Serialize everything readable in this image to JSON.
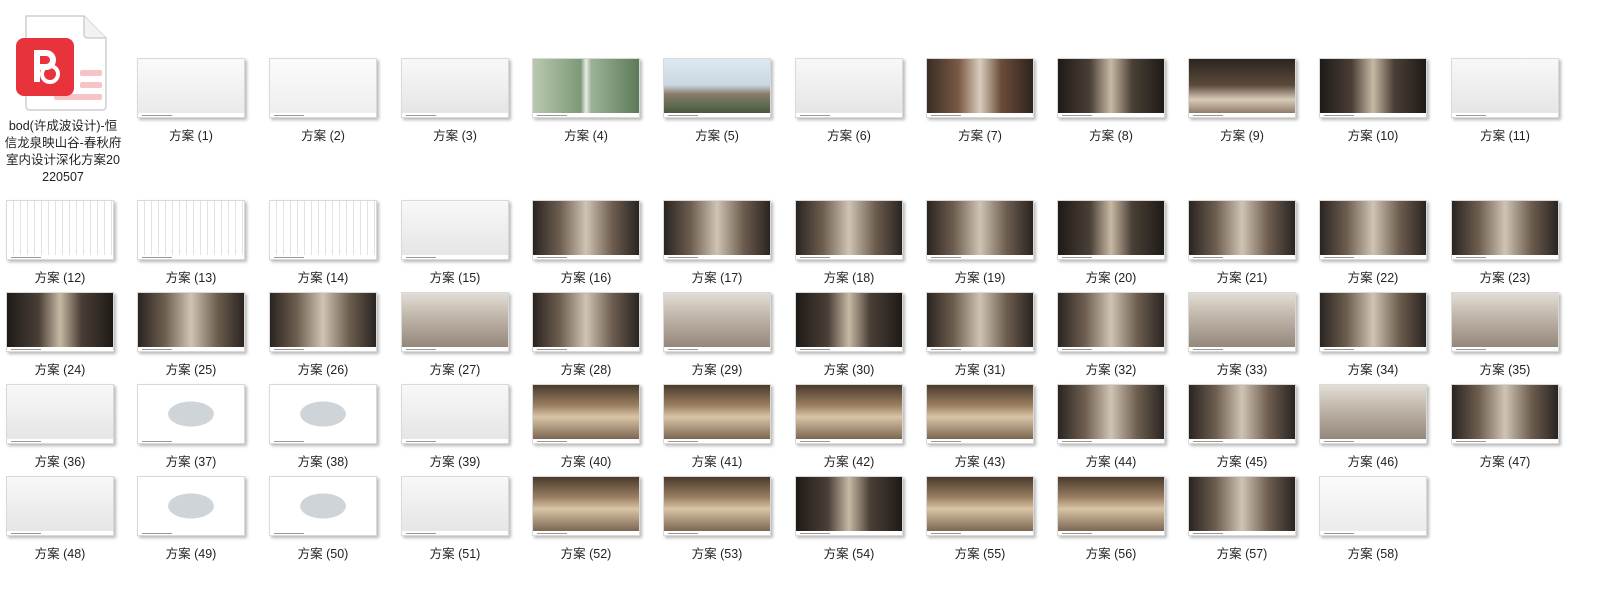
{
  "file": {
    "name": "bod(许成波设计)-恒信龙泉映山谷-春秋府室内设计深化方案20220507",
    "icon": "pdf-document-icon",
    "accent": "#e8323c"
  },
  "slides": [
    {
      "label": "方案 (1)",
      "kind": "cover"
    },
    {
      "label": "方案 (2)",
      "kind": "contents"
    },
    {
      "label": "方案 (3)",
      "kind": "blank"
    },
    {
      "label": "方案 (4)",
      "kind": "aerial"
    },
    {
      "label": "方案 (5)",
      "kind": "facade"
    },
    {
      "label": "方案 (6)",
      "kind": "blank"
    },
    {
      "label": "方案 (7)",
      "kind": "court"
    },
    {
      "label": "方案 (8)",
      "kind": "dark"
    },
    {
      "label": "方案 (9)",
      "kind": "bedroom"
    },
    {
      "label": "方案 (10)",
      "kind": "dark"
    },
    {
      "label": "方案 (11)",
      "kind": "blank"
    },
    {
      "label": "方案 (12)",
      "kind": "plan"
    },
    {
      "label": "方案 (13)",
      "kind": "plan"
    },
    {
      "label": "方案 (14)",
      "kind": "plan"
    },
    {
      "label": "方案 (15)",
      "kind": "blank"
    },
    {
      "label": "方案 (16)",
      "kind": "interior"
    },
    {
      "label": "方案 (17)",
      "kind": "interior"
    },
    {
      "label": "方案 (18)",
      "kind": "interior"
    },
    {
      "label": "方案 (19)",
      "kind": "interior"
    },
    {
      "label": "方案 (20)",
      "kind": "dark"
    },
    {
      "label": "方案 (21)",
      "kind": "interior"
    },
    {
      "label": "方案 (22)",
      "kind": "interior"
    },
    {
      "label": "方案 (23)",
      "kind": "interior"
    },
    {
      "label": "方案 (24)",
      "kind": "dark"
    },
    {
      "label": "方案 (25)",
      "kind": "interior"
    },
    {
      "label": "方案 (26)",
      "kind": "interior"
    },
    {
      "label": "方案 (27)",
      "kind": "light"
    },
    {
      "label": "方案 (28)",
      "kind": "interior"
    },
    {
      "label": "方案 (29)",
      "kind": "light"
    },
    {
      "label": "方案 (30)",
      "kind": "dark"
    },
    {
      "label": "方案 (31)",
      "kind": "interior"
    },
    {
      "label": "方案 (32)",
      "kind": "interior"
    },
    {
      "label": "方案 (33)",
      "kind": "light"
    },
    {
      "label": "方案 (34)",
      "kind": "interior"
    },
    {
      "label": "方案 (35)",
      "kind": "light"
    },
    {
      "label": "方案 (36)",
      "kind": "blank"
    },
    {
      "label": "方案 (37)",
      "kind": "plan-single"
    },
    {
      "label": "方案 (38)",
      "kind": "plan-single"
    },
    {
      "label": "方案 (39)",
      "kind": "blank"
    },
    {
      "label": "方案 (40)",
      "kind": "warm"
    },
    {
      "label": "方案 (41)",
      "kind": "warm"
    },
    {
      "label": "方案 (42)",
      "kind": "warm"
    },
    {
      "label": "方案 (43)",
      "kind": "warm"
    },
    {
      "label": "方案 (44)",
      "kind": "interior"
    },
    {
      "label": "方案 (45)",
      "kind": "interior"
    },
    {
      "label": "方案 (46)",
      "kind": "light"
    },
    {
      "label": "方案 (47)",
      "kind": "interior"
    },
    {
      "label": "方案 (48)",
      "kind": "blank"
    },
    {
      "label": "方案 (49)",
      "kind": "plan-single"
    },
    {
      "label": "方案 (50)",
      "kind": "plan-single"
    },
    {
      "label": "方案 (51)",
      "kind": "blank"
    },
    {
      "label": "方案 (52)",
      "kind": "warm"
    },
    {
      "label": "方案 (53)",
      "kind": "warm"
    },
    {
      "label": "方案 (54)",
      "kind": "dark"
    },
    {
      "label": "方案 (55)",
      "kind": "warm"
    },
    {
      "label": "方案 (56)",
      "kind": "warm"
    },
    {
      "label": "方案 (57)",
      "kind": "interior"
    },
    {
      "label": "方案 (58)",
      "kind": "thanks"
    }
  ]
}
